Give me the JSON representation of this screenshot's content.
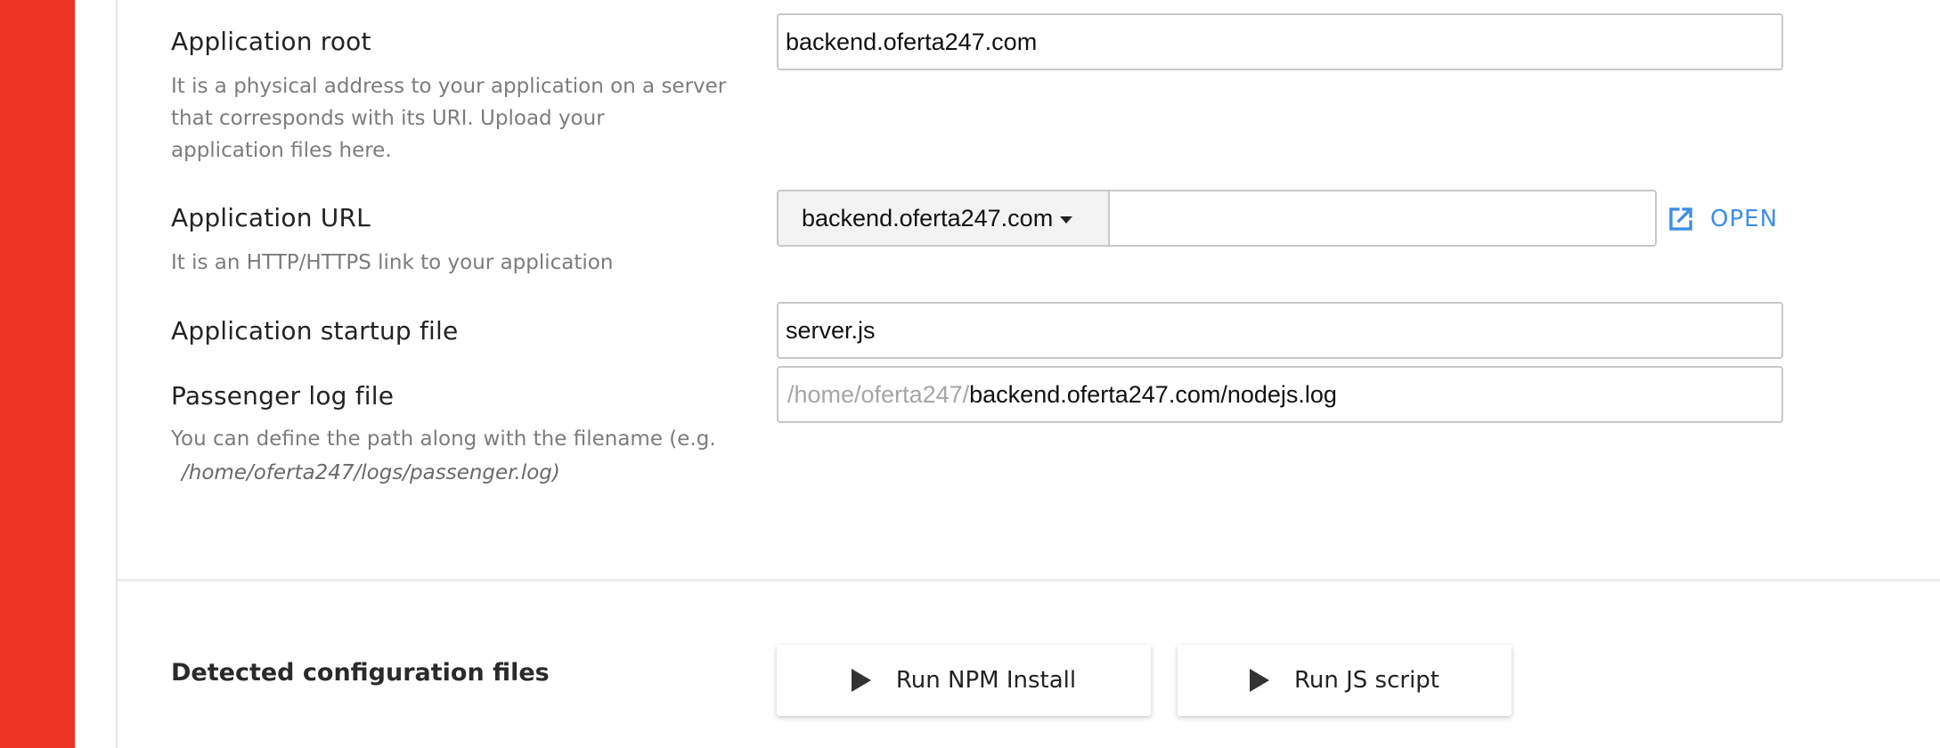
{
  "colors": {
    "sidebar": "#ee3425",
    "link": "#3f8ee6"
  },
  "app_root": {
    "label": "Application root",
    "help_lines": [
      "It is a physical address to your application on a server",
      "that corresponds with its URI. Upload your",
      "application files here."
    ],
    "value": "backend.oferta247.com"
  },
  "app_url": {
    "label": "Application URL",
    "help": "It is an HTTP/HTTPS link to your application",
    "domain": "backend.oferta247.com",
    "path_value": "",
    "open_label": "OPEN",
    "open_icon": "external-link-icon"
  },
  "startup_file": {
    "label": "Application startup file",
    "value": "server.js"
  },
  "log_file": {
    "label": "Passenger log file",
    "prefix": "/home/oferta247/",
    "value": "backend.oferta247.com/nodejs.log",
    "help_line1": "You can define the path along with the filename (e.g.",
    "help_path": "/home/oferta247/logs/passenger.log)"
  },
  "config_section": {
    "title": "Detected configuration files",
    "buttons": [
      {
        "label": "Run NPM Install",
        "icon": "play-icon"
      },
      {
        "label": "Run JS script",
        "icon": "play-icon"
      }
    ]
  }
}
